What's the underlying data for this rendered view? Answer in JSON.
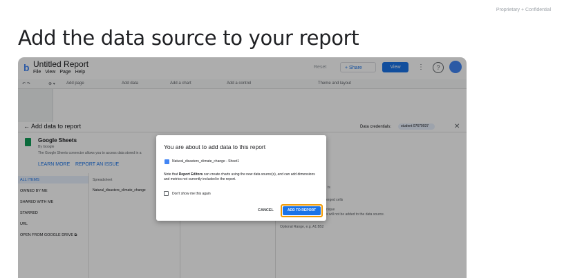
{
  "slide": {
    "confidential": "Proprietary + Confidential",
    "title": "Add the data source to your report"
  },
  "app": {
    "report_title": "Untitled Report",
    "menu": [
      "File",
      "View",
      "Page",
      "Help"
    ],
    "reset_label": "Reset",
    "share_label": "Share",
    "view_label": "View",
    "toolbar": {
      "add_page": "Add page",
      "add_data": "Add data",
      "add_chart": "Add a chart",
      "add_control": "Add a control",
      "theme": "Theme and layout"
    },
    "panel": {
      "back_label": "Add data to report",
      "credentials_label": "Data credentials:",
      "credentials_user": "student 07670037"
    },
    "connector": {
      "title": "Google Sheets",
      "by": "By Google",
      "description": "The Google Sheets connector allows you to access data stored in a",
      "learn_more": "LEARN MORE",
      "report_issue": "REPORT AN ISSUE"
    },
    "nav_items": [
      "ALL ITEMS",
      "OWNED BY ME",
      "SHARED WITH ME",
      "STARRED",
      "URL",
      "OPEN FROM GOOGLE DRIVE"
    ],
    "column_header": "Spreadsheet",
    "file_name": "Natural_disasters_climate_change",
    "right_fragments": {
      "r1": "ts",
      "r2": "erged cells",
      "r3": "nique",
      "r4": "s will not be added to the data source.",
      "r5": "Optional Range, e.g. A1:B52"
    }
  },
  "dialog": {
    "title": "You are about to add data to this report",
    "source": "Natural_disasters_climate_change - Sheet1",
    "note_prefix": "Note that ",
    "note_bold": "Report Editors",
    "note_suffix": " can create charts using the new data source(s), and can add dimensions and metrics not currently included in the report.",
    "checkbox_label": "Don't show me this again",
    "cancel_label": "CANCEL",
    "add_label": "ADD TO REPORT",
    "highlight_color": "#f29900"
  },
  "colors": {
    "accent": "#1a73e8",
    "sheets_green": "#0f9d58"
  }
}
